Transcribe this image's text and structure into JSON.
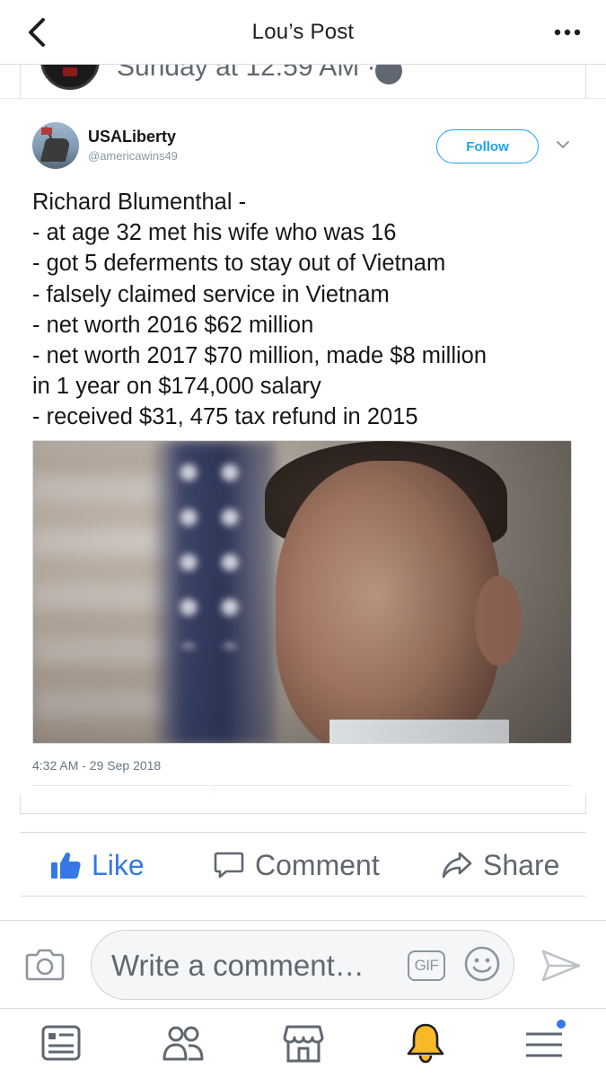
{
  "header": {
    "title": "Lou’s Post",
    "back_icon": "chevron-left-icon",
    "more_icon": "more-horizontal-icon"
  },
  "scrolled_post": {
    "timestamp": "Sunday at 12:59 AM ·"
  },
  "tweet": {
    "display_name": "USALiberty",
    "handle": "@americawins49",
    "follow_label": "Follow",
    "lines": [
      "Richard Blumenthal -",
      "- at age 32 met his wife who was 16",
      "- got 5 deferments to stay out of Vietnam",
      "- falsely claimed service in Vietnam",
      "- net worth 2016 $62 million",
      "- net worth 2017 $70 million, made $8 million",
      "in 1 year on $174,000 salary",
      "- received $31, 475 tax refund in 2015"
    ],
    "timestamp": "4:32 AM - 29 Sep 2018",
    "accent_color": "#1da1f2"
  },
  "actions": {
    "like_label": "Like",
    "comment_label": "Comment",
    "share_label": "Share",
    "like_color": "#3578e5"
  },
  "composer": {
    "placeholder": "Write a comment…",
    "gif_label": "GIF"
  },
  "tabs": [
    {
      "name": "news-feed",
      "icon": "news-feed-icon"
    },
    {
      "name": "friends",
      "icon": "friends-icon"
    },
    {
      "name": "marketplace",
      "icon": "marketplace-icon"
    },
    {
      "name": "notifications",
      "icon": "bell-icon"
    },
    {
      "name": "menu",
      "icon": "menu-icon"
    }
  ]
}
